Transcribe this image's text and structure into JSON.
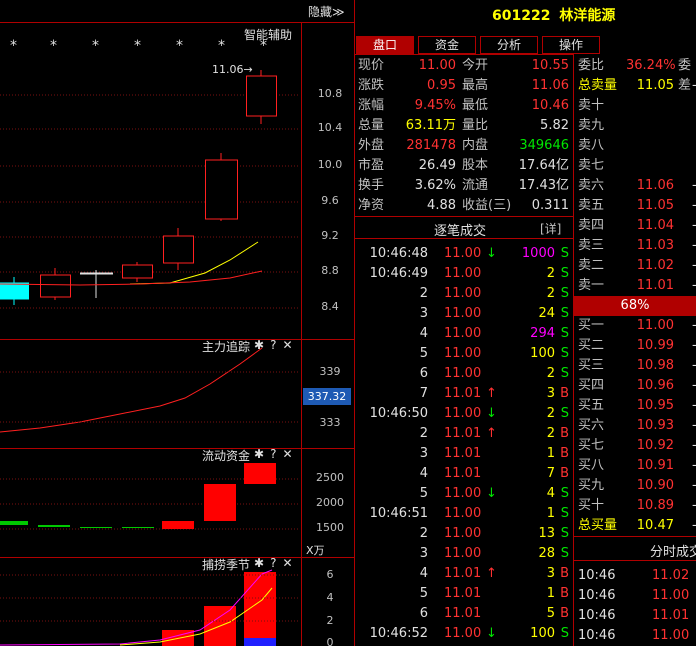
{
  "stock": {
    "code": "601222",
    "name": "林洋能源"
  },
  "top": {
    "hide_label": "隐藏≫",
    "assist_label": "智能辅助",
    "price_marker": "11.06"
  },
  "tabs": [
    "盘口",
    "资金",
    "分析",
    "操作"
  ],
  "axis_main": [
    "10.8",
    "10.4",
    "10.0",
    "9.6",
    "9.2",
    "8.8",
    "8.4"
  ],
  "panels": {
    "p1": {
      "title": "主力追踪",
      "ticks": [
        "339",
        "333"
      ],
      "current": "337.32"
    },
    "p2": {
      "title": "流动资金",
      "ticks": [
        "2500",
        "2000",
        "1500"
      ],
      "unit": "X万"
    },
    "p3": {
      "title": "捕捞季节",
      "ticks": [
        "6",
        "4",
        "2",
        "0"
      ]
    }
  },
  "panel_icons": [
    "gear-icon",
    "help-icon",
    "close-icon"
  ],
  "panel_icon_text": {
    "gear": "✱",
    "help": "?",
    "close": "✕"
  },
  "stars": "*",
  "quote": {
    "rows": [
      {
        "l1": "现价",
        "v1": "11.00",
        "l2": "今开",
        "v2": "10.55"
      },
      {
        "l1": "涨跌",
        "v1": "0.95",
        "l2": "最高",
        "v2": "11.06"
      },
      {
        "l1": "涨幅",
        "v1": "9.45%",
        "l2": "最低",
        "v2": "10.46"
      },
      {
        "l1": "总量",
        "v1": "63.11万",
        "l2": "量比",
        "v2": "5.82"
      },
      {
        "l1": "外盘",
        "v1": "281478",
        "l2": "内盘",
        "v2": "349646"
      },
      {
        "l1": "市盈",
        "v1": "26.49",
        "l2": "股本",
        "v2": "17.64亿"
      },
      {
        "l1": "换手",
        "v1": "3.62%",
        "l2": "流通",
        "v2": "17.43亿"
      },
      {
        "l1": "净资",
        "v1": "4.88",
        "l2": "收益(三)",
        "v2": "0.311"
      }
    ]
  },
  "trades_header": {
    "title": "逐笔成交",
    "detail": "[详]"
  },
  "trades": [
    {
      "t": "10:46:48",
      "p": "11.00",
      "a": "down",
      "v": "1000",
      "s": "S",
      "vc": "m"
    },
    {
      "t": "10:46:49",
      "p": "11.00",
      "a": "",
      "v": "2",
      "s": "S",
      "vc": "y"
    },
    {
      "t": "2",
      "p": "11.00",
      "a": "",
      "v": "2",
      "s": "S",
      "vc": "y"
    },
    {
      "t": "3",
      "p": "11.00",
      "a": "",
      "v": "24",
      "s": "S",
      "vc": "y"
    },
    {
      "t": "4",
      "p": "11.00",
      "a": "",
      "v": "294",
      "s": "S",
      "vc": "m"
    },
    {
      "t": "5",
      "p": "11.00",
      "a": "",
      "v": "100",
      "s": "S",
      "vc": "y"
    },
    {
      "t": "6",
      "p": "11.00",
      "a": "",
      "v": "2",
      "s": "S",
      "vc": "y"
    },
    {
      "t": "7",
      "p": "11.01",
      "a": "up",
      "v": "3",
      "s": "B",
      "vc": "y"
    },
    {
      "t": "10:46:50",
      "p": "11.00",
      "a": "down",
      "v": "2",
      "s": "S",
      "vc": "y"
    },
    {
      "t": "2",
      "p": "11.01",
      "a": "up",
      "v": "2",
      "s": "B",
      "vc": "y"
    },
    {
      "t": "3",
      "p": "11.01",
      "a": "",
      "v": "1",
      "s": "B",
      "vc": "y"
    },
    {
      "t": "4",
      "p": "11.01",
      "a": "",
      "v": "7",
      "s": "B",
      "vc": "y"
    },
    {
      "t": "5",
      "p": "11.00",
      "a": "down",
      "v": "4",
      "s": "S",
      "vc": "y"
    },
    {
      "t": "10:46:51",
      "p": "11.00",
      "a": "",
      "v": "1",
      "s": "S",
      "vc": "y"
    },
    {
      "t": "2",
      "p": "11.00",
      "a": "",
      "v": "13",
      "s": "S",
      "vc": "y"
    },
    {
      "t": "3",
      "p": "11.00",
      "a": "",
      "v": "28",
      "s": "S",
      "vc": "y"
    },
    {
      "t": "4",
      "p": "11.01",
      "a": "up",
      "v": "3",
      "s": "B",
      "vc": "y"
    },
    {
      "t": "5",
      "p": "11.01",
      "a": "",
      "v": "1",
      "s": "B",
      "vc": "y"
    },
    {
      "t": "6",
      "p": "11.01",
      "a": "",
      "v": "5",
      "s": "B",
      "vc": "y"
    },
    {
      "t": "10:46:52",
      "p": "11.00",
      "a": "down",
      "v": "100",
      "s": "S",
      "vc": "y"
    }
  ],
  "orderbook": {
    "weibi_label": "委比",
    "weibi_value": "36.24%",
    "weicha_label": "委差",
    "total_sell_label": "总卖量",
    "total_sell_value": "11.05",
    "sells": [
      {
        "l": "卖十",
        "p": "-"
      },
      {
        "l": "卖九",
        "p": "-"
      },
      {
        "l": "卖八",
        "p": "-"
      },
      {
        "l": "卖七",
        "p": "-"
      },
      {
        "l": "卖六",
        "p": "11.06"
      },
      {
        "l": "卖五",
        "p": "11.05"
      },
      {
        "l": "卖四",
        "p": "11.04"
      },
      {
        "l": "卖三",
        "p": "11.03"
      },
      {
        "l": "卖二",
        "p": "11.02"
      },
      {
        "l": "卖一",
        "p": "11.01"
      }
    ],
    "ratio": "68%",
    "buys": [
      {
        "l": "买一",
        "p": "11.00"
      },
      {
        "l": "买二",
        "p": "10.99"
      },
      {
        "l": "买三",
        "p": "10.98"
      },
      {
        "l": "买四",
        "p": "10.96"
      },
      {
        "l": "买五",
        "p": "10.95"
      },
      {
        "l": "买六",
        "p": "10.93"
      },
      {
        "l": "买七",
        "p": "10.92"
      },
      {
        "l": "买八",
        "p": "10.91"
      },
      {
        "l": "买九",
        "p": "10.90"
      },
      {
        "l": "买十",
        "p": "10.89"
      }
    ],
    "total_buy_label": "总买量",
    "total_buy_value": "10.47"
  },
  "minute_header": "分时成交",
  "minute_trades": [
    {
      "t": "10:46",
      "p": "11.02"
    },
    {
      "t": "10:46",
      "p": "11.00"
    },
    {
      "t": "10:46",
      "p": "11.01"
    },
    {
      "t": "10:46",
      "p": "11.00"
    }
  ],
  "colors": {
    "up": "#ff3232",
    "down": "#00e600",
    "flat": "#e0e0e0",
    "accent": "#b00000",
    "volume": "#ffff00",
    "bigvolume": "#ff00ff"
  }
}
